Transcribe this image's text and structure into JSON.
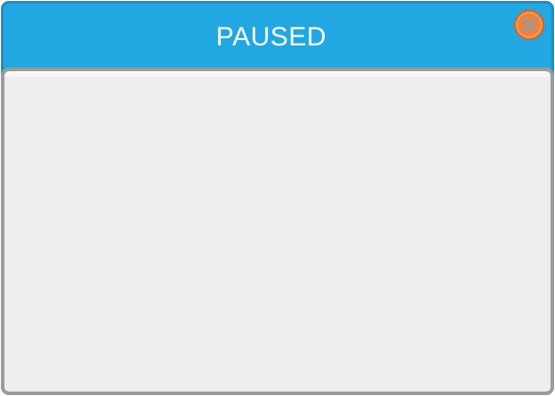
{
  "dialog": {
    "title": "PAUSED",
    "close_icon": "close-icon"
  },
  "colors": {
    "header": "#21a8e2",
    "header_border": "#1d8fc4",
    "close_button": "#f2813a",
    "close_glyph": "#9a9a9a",
    "body": "#eeeeee",
    "body_border": "#9b9b9b"
  }
}
